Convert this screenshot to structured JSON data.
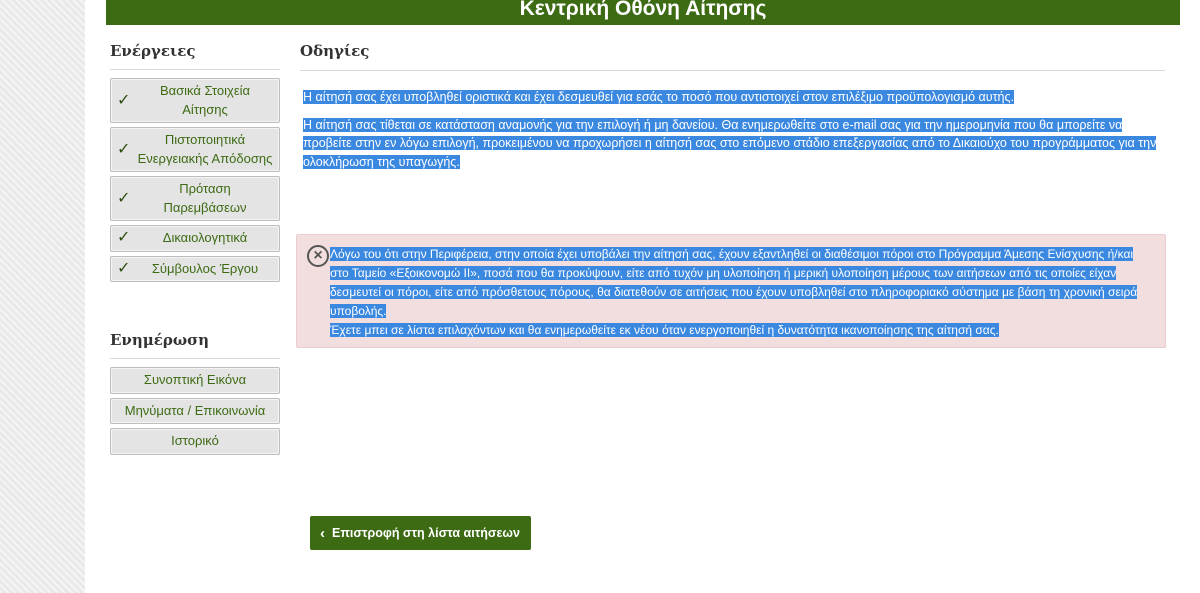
{
  "header": {
    "title": "Κεντρική Οθόνη Αίτησης"
  },
  "sidebar": {
    "actions_heading": "Ενέργειες",
    "actions": [
      {
        "label": "Βασικά Στοιχεία Αίτησης",
        "checked": true,
        "icon": "check-icon"
      },
      {
        "label": "Πιστοποιητικά Ενεργειακής Απόδοσης",
        "checked": true,
        "icon": "check-icon"
      },
      {
        "label": "Πρόταση Παρεμβάσεων",
        "checked": true,
        "icon": "check-icon"
      },
      {
        "label": "Δικαιολογητικά",
        "checked": true,
        "icon": "check-icon"
      },
      {
        "label": "Σύμβουλος Έργου",
        "checked": true,
        "icon": "check-icon"
      }
    ],
    "info_heading": "Ενημέρωση",
    "info_items": [
      {
        "label": "Συνοπτική Εικόνα"
      },
      {
        "label": "Μηνύματα / Επικοινωνία"
      },
      {
        "label": "Ιστορικό"
      }
    ]
  },
  "main": {
    "heading": "Οδηγίες",
    "paragraph1": "Η αίτησή σας έχει υποβληθεί οριστικά και έχει δεσμευθεί για εσάς το ποσό που αντιστοιχεί στον επιλέξιμο προϋπολογισμό αυτής.",
    "paragraph2": "Η αίτησή σας τίθεται σε κατάσταση αναμονής για την επιλογή ή μη δανείου. Θα ενημερωθείτε στο e-mail σας για την ημερομηνία που θα μπορείτε να προβείτε στην εν λόγω επιλογή, προκειμένου να προχωρήσει η αίτησή σας στο επόμενο στάδιο επεξεργασίας από το Δικαιούχο του προγράμματος για την ολοκλήρωση της υπαγωγής.",
    "alert": {
      "icon": "circle-x-icon",
      "text1": "Λόγω του ότι στην Περιφέρεια, στην οποία έχει υποβάλει την αίτησή σας, έχουν εξαντληθεί οι διαθέσιμοι πόροι στο Πρόγραμμα Άμεσης Ενίσχυσης ή/και στο Ταμείο «Εξοικονομώ ΙΙ», ποσά που θα προκύψουν, είτε από τυχόν μη υλοποίηση ή μερική υλοποίηση μέρους των αιτήσεων από τις οποίες είχαν δεσμευτεί οι πόροι, είτε από πρόσθετους πόρους, θα διατεθούν σε αιτήσεις που έχουν υποβληθεί στο πληροφοριακό σύστημα με βάση τη χρονική σειρά υποβολής.",
      "text2": "Έχετε μπει σε λίστα επιλαχόντων και θα ενημερωθείτε εκ νέου όταν ενεργοποιηθεί η δυνατότητα ικανοποίησης της αίτησή σας."
    },
    "back_button": {
      "label": "Επιστροφή στη λίστα αιτήσεων",
      "icon": "chevron-left-icon"
    }
  },
  "colors": {
    "primary_green": "#3d6b14",
    "selection_blue": "#3b88e0",
    "alert_bg": "#f2dede"
  }
}
